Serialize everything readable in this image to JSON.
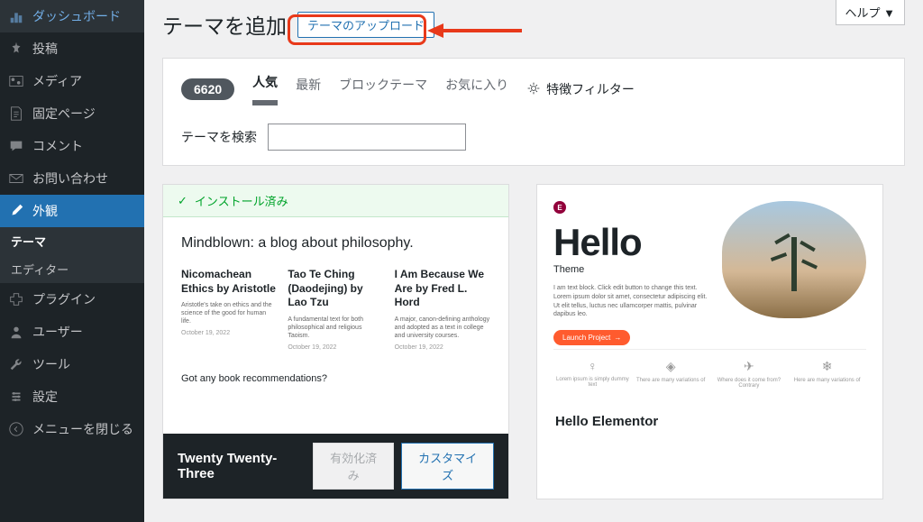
{
  "help_label": "ヘルプ ▼",
  "sidebar": {
    "items": [
      {
        "icon": "dashboard",
        "label": "ダッシュボード"
      },
      {
        "icon": "pin",
        "label": "投稿"
      },
      {
        "icon": "media",
        "label": "メディア"
      },
      {
        "icon": "page",
        "label": "固定ページ"
      },
      {
        "icon": "comment",
        "label": "コメント"
      },
      {
        "icon": "mail",
        "label": "お問い合わせ"
      },
      {
        "icon": "brush",
        "label": "外観"
      },
      {
        "icon": "plugin",
        "label": "プラグイン"
      },
      {
        "icon": "user",
        "label": "ユーザー"
      },
      {
        "icon": "wrench",
        "label": "ツール"
      },
      {
        "icon": "settings",
        "label": "設定"
      },
      {
        "icon": "collapse",
        "label": "メニューを閉じる"
      }
    ],
    "submenu": [
      {
        "label": "テーマ",
        "active": true
      },
      {
        "label": "エディター",
        "active": false
      }
    ]
  },
  "page": {
    "title": "テーマを追加",
    "upload_btn": "テーマのアップロード"
  },
  "filter": {
    "count": "6620",
    "tabs": [
      {
        "label": "人気",
        "active": true
      },
      {
        "label": "最新",
        "active": false
      },
      {
        "label": "ブロックテーマ",
        "active": false
      },
      {
        "label": "お気に入り",
        "active": false
      }
    ],
    "feature_filter": "特徴フィルター",
    "search_label": "テーマを検索",
    "search_placeholder": ""
  },
  "themes": [
    {
      "installed": true,
      "installed_label": "インストール済み",
      "preview": {
        "title": "Mindblown: a blog about philosophy.",
        "cols": [
          {
            "heading": "Nicomachean Ethics by Aristotle",
            "text": "Aristotle's take on ethics and the science of the good for human life.",
            "date": "October 19, 2022"
          },
          {
            "heading": "Tao Te Ching (Daodejing) by Lao Tzu",
            "text": "A fundamental text for both philosophical and religious Taoism.",
            "date": "October 19, 2022"
          },
          {
            "heading": "I Am Because We Are by Fred L. Hord",
            "text": "A major, canon-defining anthology and adopted as a text in college and university courses.",
            "date": "October 19, 2022"
          }
        ],
        "footer_text": "Got any book recommendations?"
      },
      "name": "Twenty Twenty-Three",
      "activated_label": "有効化済み",
      "customize_label": "カスタマイズ"
    },
    {
      "installed": false,
      "preview": {
        "hello_title": "Hello",
        "hello_subtitle": "Theme",
        "hello_text": "I am text block. Click edit button to change this text. Lorem ipsum dolor sit amet, consectetur adipiscing elit. Ut elit tellus, luctus nec ullamcorper mattis, pulvinar dapibus leo.",
        "launch_btn": "Launch Project",
        "features": [
          {
            "icon": "bulb",
            "text": "Lorem ipsum is simply dummy text"
          },
          {
            "icon": "diamond",
            "text": "There are many variations of"
          },
          {
            "icon": "plane",
            "text": "Where does it come from? Contrary"
          },
          {
            "icon": "snowflake",
            "text": "Here are many variations of"
          }
        ]
      },
      "name": "Hello Elementor"
    }
  ]
}
